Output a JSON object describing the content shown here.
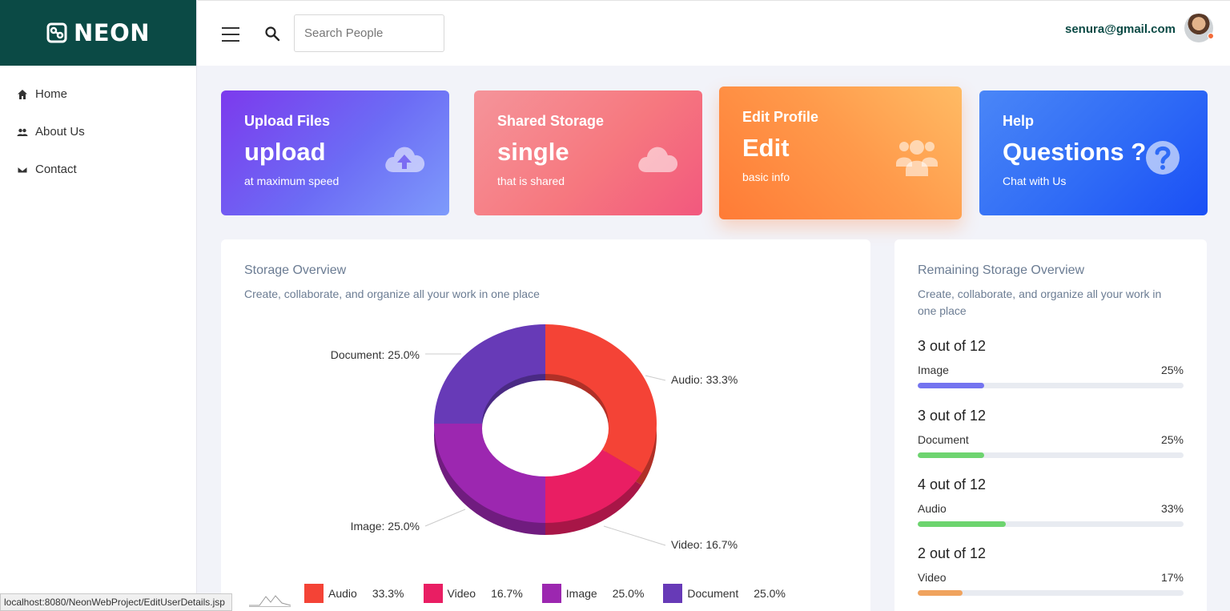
{
  "brand": {
    "name": "NEON"
  },
  "nav": [
    {
      "label": "Home",
      "icon": "home-icon"
    },
    {
      "label": "About Us",
      "icon": "people-icon"
    },
    {
      "label": "Contact",
      "icon": "envelope-icon"
    }
  ],
  "header": {
    "search_placeholder": "Search People",
    "user_email": "senura@gmail.com"
  },
  "cards": [
    {
      "title": "Upload Files",
      "big": "upload",
      "sub": "at maximum speed",
      "icon": "cloud-upload-icon"
    },
    {
      "title": "Shared Storage",
      "big": "single",
      "sub": "that is shared",
      "icon": "cloud-icon"
    },
    {
      "title": "Edit Profile",
      "big": "Edit",
      "sub": "basic info",
      "icon": "users-icon"
    },
    {
      "title": "Help",
      "big": "Questions ?",
      "sub": "Chat with Us",
      "icon": "question-circle-icon"
    }
  ],
  "storage_overview": {
    "title": "Storage Overview",
    "description": "Create, collaborate, and organize all your work in one place"
  },
  "chart_data": {
    "type": "pie",
    "variant": "3d-donut",
    "slices": [
      {
        "name": "Audio",
        "value": 33.3,
        "label": "Audio: 33.3%",
        "legend_pct": "33.3%",
        "color": "#f44336"
      },
      {
        "name": "Video",
        "value": 16.7,
        "label": "Video: 16.7%",
        "legend_pct": "16.7%",
        "color": "#e91e63"
      },
      {
        "name": "Image",
        "value": 25.0,
        "label": "Image: 25.0%",
        "legend_pct": "25.0%",
        "color": "#9c27b0"
      },
      {
        "name": "Document",
        "value": 25.0,
        "label": "Document: 25.0%",
        "legend_pct": "25.0%",
        "color": "#673ab7"
      }
    ],
    "legend_placement": "bottom"
  },
  "remaining": {
    "title": "Remaining Storage Overview",
    "description": "Create, collaborate, and organize all your work in one place",
    "items": [
      {
        "count": "3 out of 12",
        "label": "Image",
        "pct": "25%",
        "fraction": 0.25,
        "color": "#7474f0"
      },
      {
        "count": "3 out of 12",
        "label": "Document",
        "pct": "25%",
        "fraction": 0.25,
        "color": "#6dd46f"
      },
      {
        "count": "4 out of 12",
        "label": "Audio",
        "pct": "33%",
        "fraction": 0.33,
        "color": "#6dd46f"
      },
      {
        "count": "2 out of 12",
        "label": "Video",
        "pct": "17%",
        "fraction": 0.17,
        "color": "#f0a35e"
      }
    ]
  },
  "status_bar": {
    "url": "localhost:8080/NeonWebProject/EditUserDetails.jsp"
  }
}
